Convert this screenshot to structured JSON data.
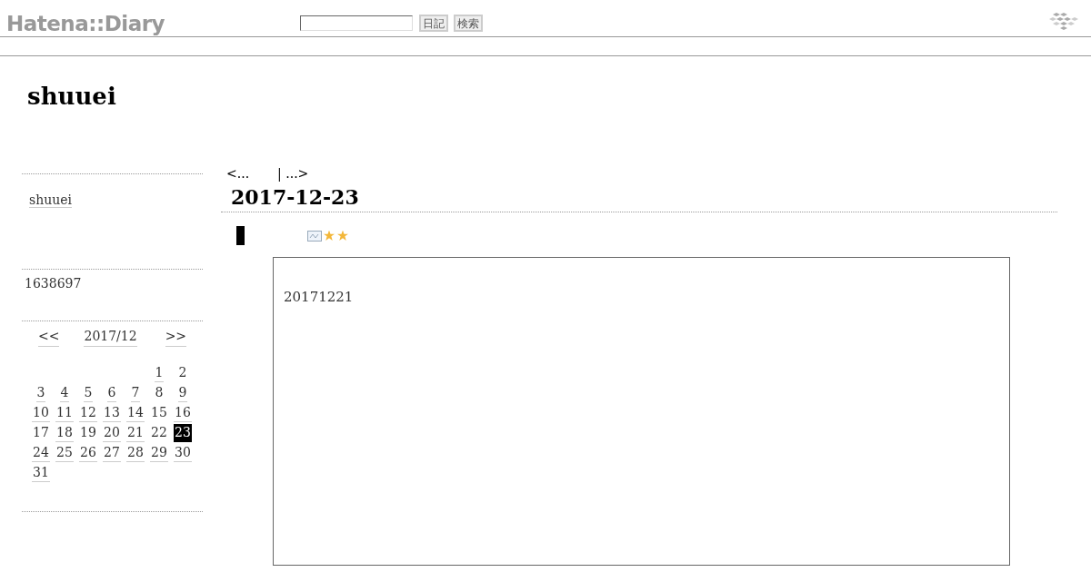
{
  "header": {
    "logo": "Hatena::Diary",
    "buttons": [
      "日記",
      "検索"
    ]
  },
  "diary_title": "shuuei",
  "sidebar": {
    "profile": "shuuei",
    "counter": "1638697",
    "calendar": {
      "prev": "<<",
      "month": "2017/12",
      "next": ">>",
      "weeks": [
        [
          {
            "day": "1",
            "link": true,
            "selected": false
          },
          {
            "day": "2",
            "link": false,
            "selected": false
          }
        ],
        [
          {
            "day": "3",
            "link": true,
            "selected": false
          },
          {
            "day": "4",
            "link": true,
            "selected": false
          },
          {
            "day": "5",
            "link": true,
            "selected": false
          },
          {
            "day": "6",
            "link": true,
            "selected": false
          },
          {
            "day": "7",
            "link": true,
            "selected": false
          },
          {
            "day": "8",
            "link": false,
            "selected": false
          },
          {
            "day": "9",
            "link": true,
            "selected": false
          }
        ],
        [
          {
            "day": "10",
            "link": true,
            "selected": false
          },
          {
            "day": "11",
            "link": true,
            "selected": false
          },
          {
            "day": "12",
            "link": true,
            "selected": false
          },
          {
            "day": "13",
            "link": true,
            "selected": false
          },
          {
            "day": "14",
            "link": true,
            "selected": false
          },
          {
            "day": "15",
            "link": false,
            "selected": false
          },
          {
            "day": "16",
            "link": true,
            "selected": false
          }
        ],
        [
          {
            "day": "17",
            "link": false,
            "selected": false
          },
          {
            "day": "18",
            "link": true,
            "selected": false
          },
          {
            "day": "19",
            "link": false,
            "selected": false
          },
          {
            "day": "20",
            "link": true,
            "selected": false
          },
          {
            "day": "21",
            "link": true,
            "selected": false
          },
          {
            "day": "22",
            "link": false,
            "selected": false
          },
          {
            "day": "23",
            "link": true,
            "selected": true
          }
        ],
        [
          {
            "day": "24",
            "link": true,
            "selected": false
          },
          {
            "day": "25",
            "link": true,
            "selected": false
          },
          {
            "day": "26",
            "link": true,
            "selected": false
          },
          {
            "day": "27",
            "link": true,
            "selected": false
          },
          {
            "day": "28",
            "link": true,
            "selected": false
          },
          {
            "day": "29",
            "link": true,
            "selected": false
          },
          {
            "day": "30",
            "link": true,
            "selected": false
          }
        ],
        [
          {
            "day": "31",
            "link": true,
            "selected": false
          }
        ]
      ]
    }
  },
  "main": {
    "prev_link": "<...",
    "next_link": "| ...>",
    "date": "2017-12-23",
    "hatena_stars": [
      {
        "kind": "yellow"
      },
      {
        "kind": "yellow"
      }
    ],
    "entry_text": "20171221"
  }
}
